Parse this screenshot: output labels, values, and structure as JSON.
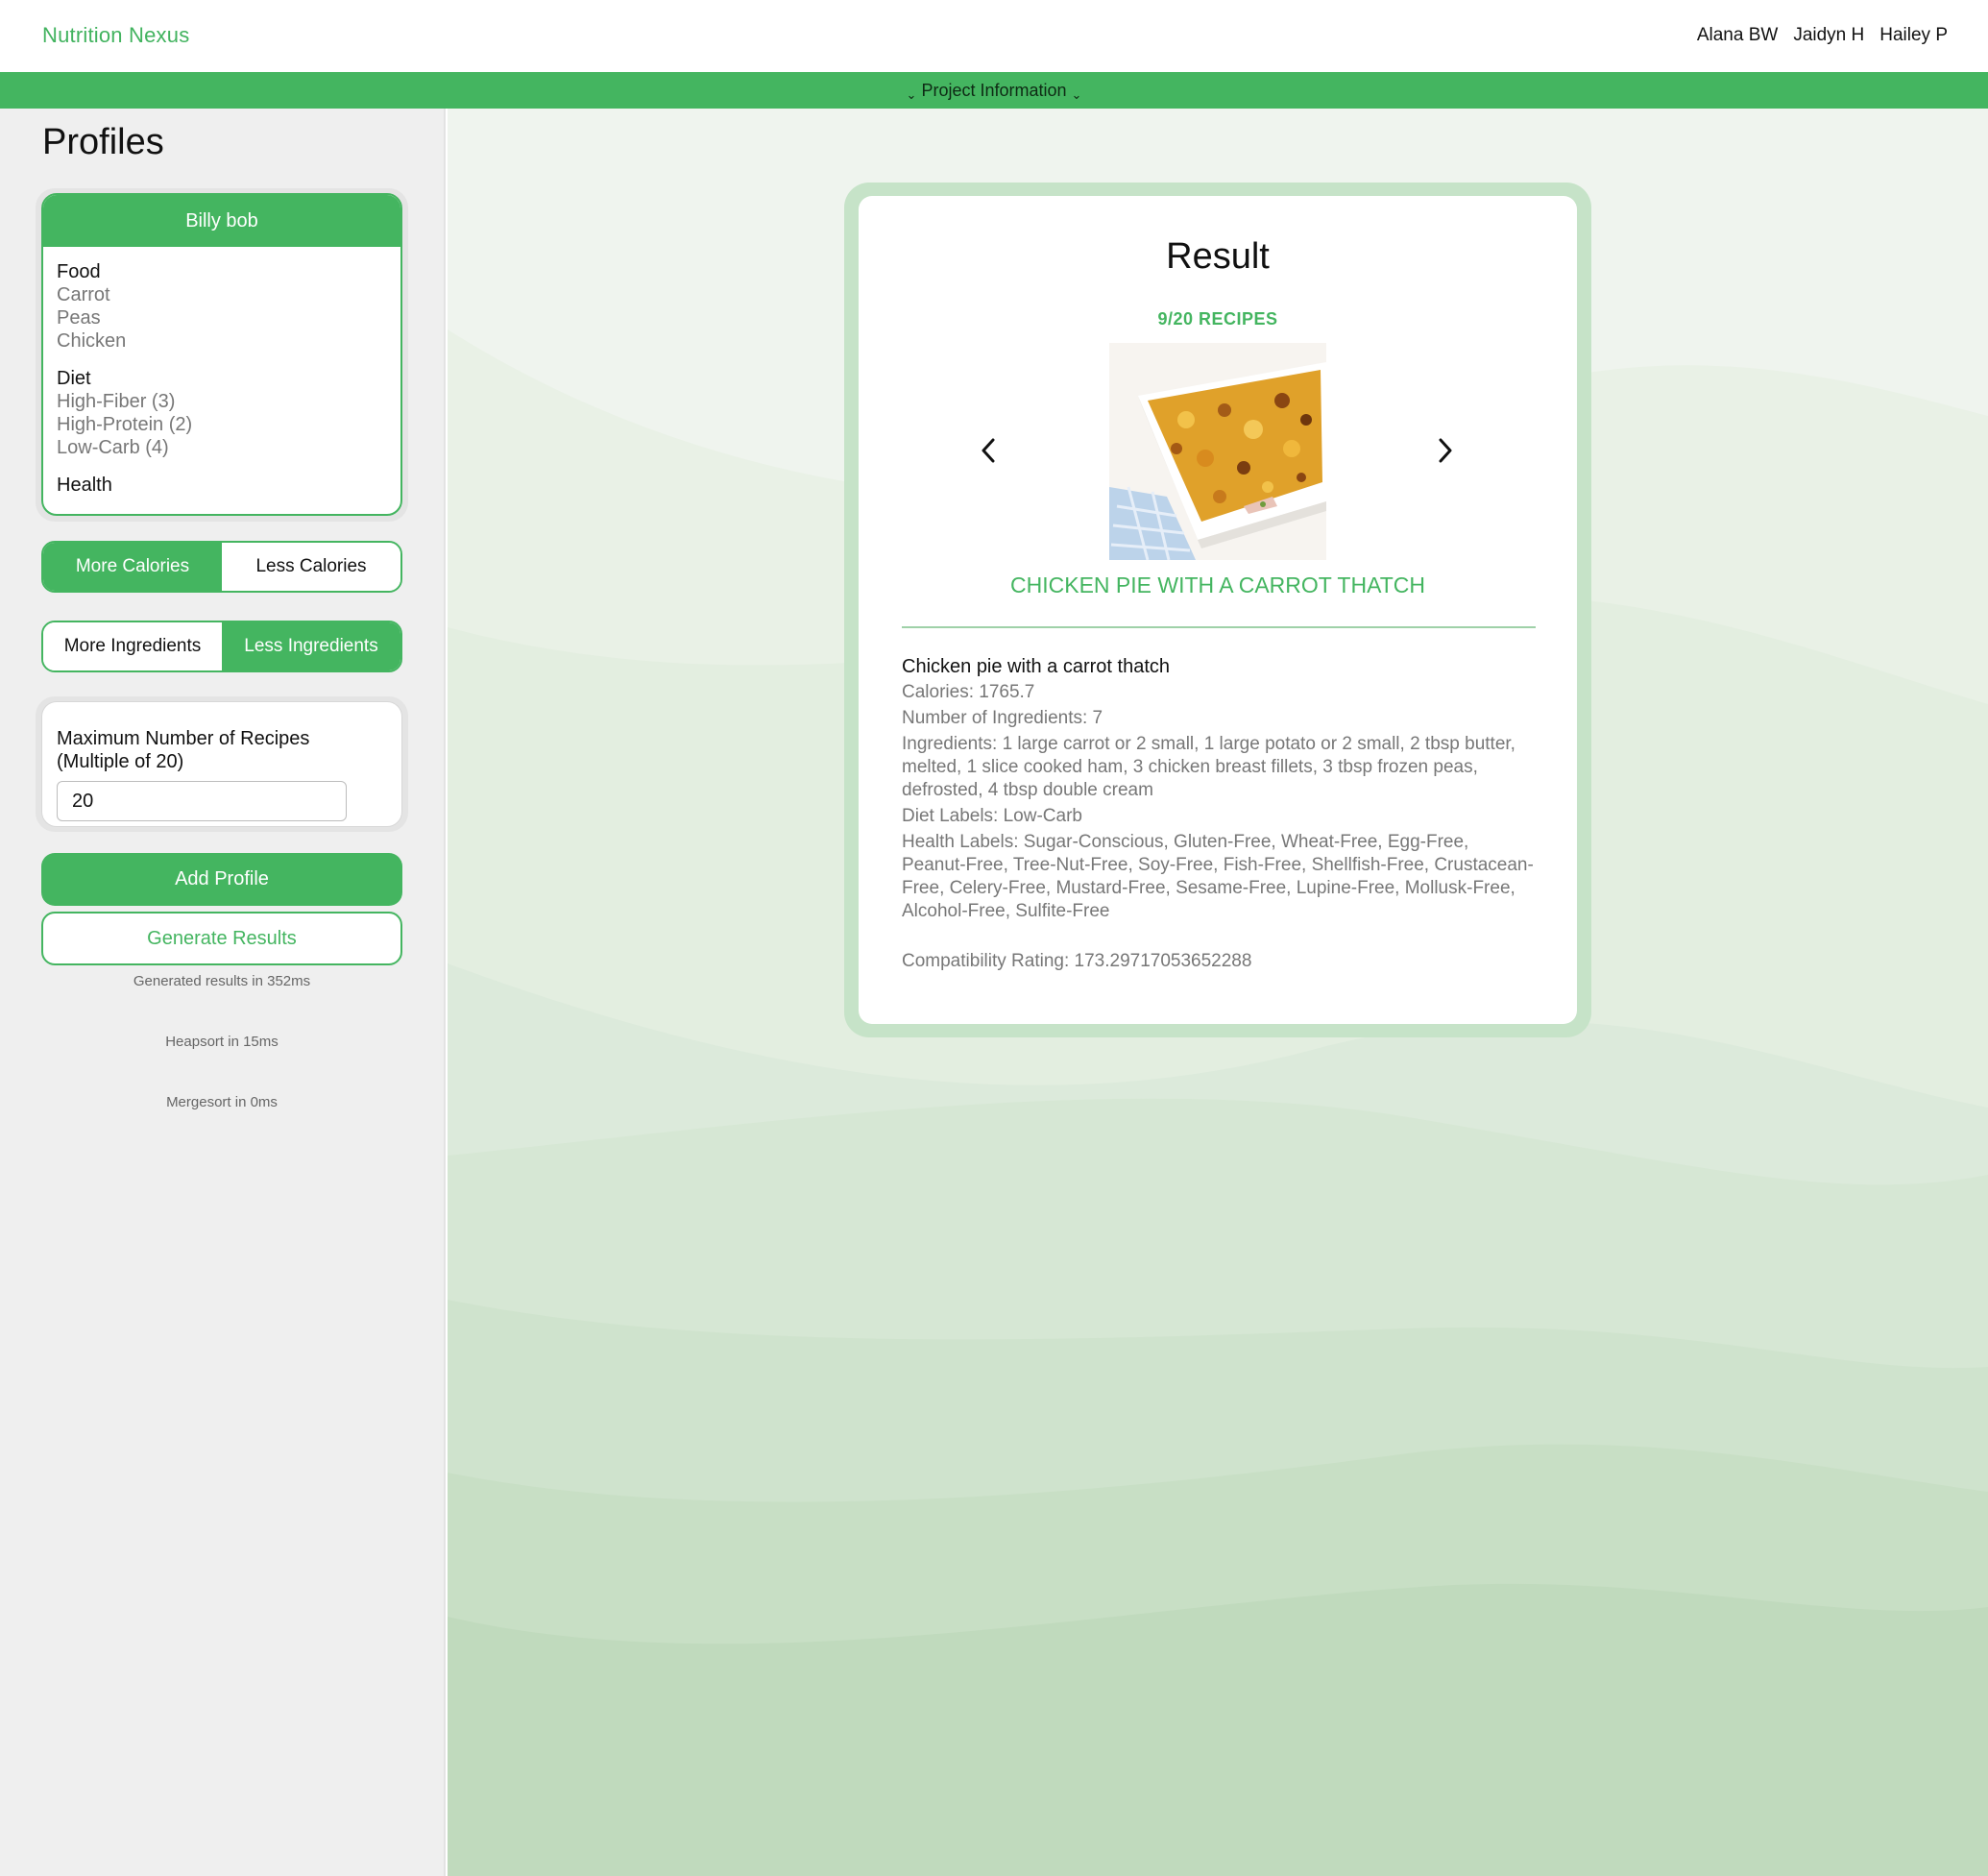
{
  "app": {
    "brand": "Nutrition Nexus",
    "authors": [
      "Alana BW",
      "Jaidyn H",
      "Hailey P"
    ],
    "info_bar": "Project Information"
  },
  "sidebar": {
    "title": "Profiles",
    "profile": {
      "name": "Billy bob",
      "food_heading": "Food",
      "foods": [
        "Carrot",
        "Peas",
        "Chicken"
      ],
      "diet_heading": "Diet",
      "diets": [
        "High-Fiber (3)",
        "High-Protein (2)",
        "Low-Carb (4)"
      ],
      "health_heading": "Health"
    },
    "calories_toggle": {
      "options": [
        "More Calories",
        "Less Calories"
      ],
      "selected": "More Calories"
    },
    "ingredients_toggle": {
      "options": [
        "More Ingredients",
        "Less Ingredients"
      ],
      "selected": "Less Ingredients"
    },
    "max_recipes": {
      "label": "Maximum Number of Recipes (Multiple of 20)",
      "value": "20"
    },
    "add_profile_label": "Add Profile",
    "generate_label": "Generate Results",
    "stats": [
      "Generated results in 352ms",
      "Heapsort in 15ms",
      "Mergesort in 0ms"
    ]
  },
  "result": {
    "title": "Result",
    "count": "9/20 RECIPES",
    "recipe_title_caps": "CHICKEN PIE WITH A CARROT THATCH",
    "recipe_title": "Chicken pie with a carrot thatch",
    "calories": "Calories: 1765.7",
    "num_ingredients": "Number of Ingredients: 7",
    "ingredients": "Ingredients: 1 large carrot or 2 small, 1 large potato or 2 small, 2 tbsp butter, melted, 1 slice cooked ham, 3 chicken breast fillets, 3 tbsp frozen peas, defrosted, 4 tbsp double cream",
    "diet_labels": "Diet Labels: Low-Carb",
    "health_labels": "Health Labels: Sugar-Conscious, Gluten-Free, Wheat-Free, Egg-Free, Peanut-Free, Tree-Nut-Free, Soy-Free, Fish-Free, Shellfish-Free, Crustacean-Free, Celery-Free, Mustard-Free, Sesame-Free, Lupine-Free, Mollusk-Free, Alcohol-Free, Sulfite-Free",
    "rating": "Compatibility Rating: 173.29717053652288",
    "image_icon": "recipe-photo"
  },
  "colors": {
    "accent": "#44b560",
    "brand_text": "#42b35f",
    "frame": "#c6e3c8",
    "sidebar_bg": "#efefef",
    "main_bg": "#eff4ee"
  }
}
